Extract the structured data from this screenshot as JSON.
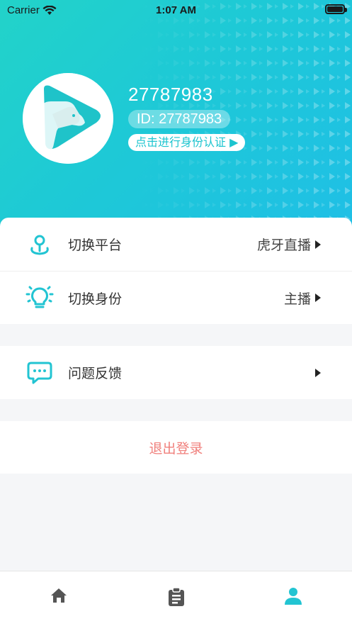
{
  "status_bar": {
    "carrier": "Carrier",
    "time": "1:07 AM",
    "wifi_icon": "wifi-icon",
    "battery_icon": "battery-icon"
  },
  "profile": {
    "avatar_icon": "app-logo-avatar",
    "name": "27787983",
    "id_label": "ID: 27787983",
    "verify_label": "点击进行身份认证 ▶"
  },
  "menu": {
    "platform": {
      "icon": "location-pin-icon",
      "label": "切换平台",
      "value": "虎牙直播"
    },
    "identity": {
      "icon": "lightbulb-icon",
      "label": "切换身份",
      "value": "主播"
    },
    "feedback": {
      "icon": "chat-bubble-icon",
      "label": "问题反馈"
    }
  },
  "logout_label": "退出登录",
  "tabs": [
    {
      "icon": "home-icon",
      "active": false
    },
    {
      "icon": "clipboard-icon",
      "active": false
    },
    {
      "icon": "person-icon",
      "active": true
    }
  ],
  "colors": {
    "accent": "#22c4d2",
    "logout": "#f07f7b",
    "tab_inactive": "#555555"
  }
}
